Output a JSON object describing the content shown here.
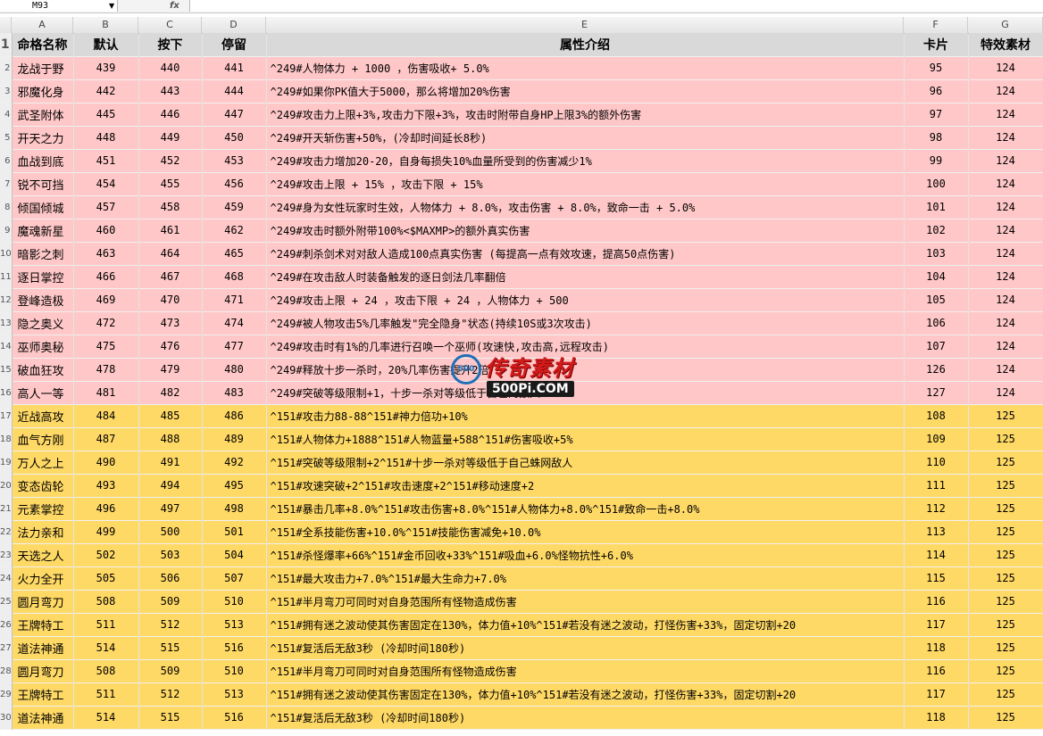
{
  "formula_bar": {
    "name_box": "M93",
    "fx": "fx"
  },
  "columns": [
    "A",
    "B",
    "C",
    "D",
    "E",
    "F",
    "G"
  ],
  "header_row": {
    "row_number": "1",
    "cells": [
      "命格名称",
      "默认",
      "按下",
      "停留",
      "属性介绍",
      "卡片",
      "特效素材"
    ]
  },
  "rows": [
    {
      "rn": "2",
      "group": "pink",
      "cells": [
        "龙战于野",
        "439",
        "440",
        "441",
        "^249#人物体力 + 1000 ，伤害吸收+ 5.0%",
        "95",
        "124"
      ]
    },
    {
      "rn": "3",
      "group": "pink",
      "cells": [
        "邪魔化身",
        "442",
        "443",
        "444",
        "^249#如果你PK值大于5000，那么将增加20%伤害",
        "96",
        "124"
      ]
    },
    {
      "rn": "4",
      "group": "pink",
      "cells": [
        "武圣附体",
        "445",
        "446",
        "447",
        "^249#攻击力上限+3%,攻击力下限+3%，攻击时附带自身HP上限3%的额外伤害",
        "97",
        "124"
      ]
    },
    {
      "rn": "5",
      "group": "pink",
      "cells": [
        "开天之力",
        "448",
        "449",
        "450",
        "^249#开天斩伤害+50%，(冷却时间延长8秒)",
        "98",
        "124"
      ]
    },
    {
      "rn": "6",
      "group": "pink",
      "cells": [
        "血战到底",
        "451",
        "452",
        "453",
        "^249#攻击力增加20-20，自身每损失10%血量所受到的伤害减少1%",
        "99",
        "124"
      ]
    },
    {
      "rn": "7",
      "group": "pink",
      "cells": [
        "锐不可挡",
        "454",
        "455",
        "456",
        "^249#攻击上限 + 15% ，攻击下限 + 15%",
        "100",
        "124"
      ]
    },
    {
      "rn": "8",
      "group": "pink",
      "cells": [
        "倾国倾城",
        "457",
        "458",
        "459",
        "^249#身为女性玩家时生效，人物体力 + 8.0%，攻击伤害 + 8.0%，致命一击 + 5.0%",
        "101",
        "124"
      ]
    },
    {
      "rn": "9",
      "group": "pink",
      "cells": [
        "魔魂新星",
        "460",
        "461",
        "462",
        "^249#攻击时额外附带100%<$MAXMP>的额外真实伤害",
        "102",
        "124"
      ]
    },
    {
      "rn": "10",
      "group": "pink",
      "cells": [
        "暗影之刺",
        "463",
        "464",
        "465",
        "^249#刺杀剑术对对敌人造成100点真实伤害 (每提高一点有效攻速，提高50点伤害)",
        "103",
        "124"
      ]
    },
    {
      "rn": "11",
      "group": "pink",
      "cells": [
        "逐日掌控",
        "466",
        "467",
        "468",
        "^249#在攻击敌人时装备触发的逐日剑法几率翻倍",
        "104",
        "124"
      ]
    },
    {
      "rn": "12",
      "group": "pink",
      "cells": [
        "登峰造极",
        "469",
        "470",
        "471",
        "^249#攻击上限 + 24 ，攻击下限 + 24 ，人物体力 + 500",
        "105",
        "124"
      ]
    },
    {
      "rn": "13",
      "group": "pink",
      "cells": [
        "隐之奥义",
        "472",
        "473",
        "474",
        "^249#被人物攻击5%几率触发\"完全隐身\"状态(持续10S或3次攻击)",
        "106",
        "124"
      ]
    },
    {
      "rn": "14",
      "group": "pink",
      "cells": [
        "巫师奥秘",
        "475",
        "476",
        "477",
        "^249#攻击时有1%的几率进行召唤一个巫师(攻速快,攻击高,远程攻击)",
        "107",
        "124"
      ]
    },
    {
      "rn": "15",
      "group": "pink",
      "cells": [
        "破血狂攻",
        "478",
        "479",
        "480",
        "^249#释放十步一杀时，20%几率伤害提升2倍",
        "126",
        "124"
      ]
    },
    {
      "rn": "16",
      "group": "pink",
      "cells": [
        "高人一等",
        "481",
        "482",
        "483",
        "^249#突破等级限制+1，十步一杀对等级低于自己的敌人",
        "127",
        "124"
      ]
    },
    {
      "rn": "17",
      "group": "gold",
      "cells": [
        "近战高攻",
        "484",
        "485",
        "486",
        "^151#攻击力88-88^151#神力倍功+10%",
        "108",
        "125"
      ]
    },
    {
      "rn": "18",
      "group": "gold",
      "cells": [
        "血气方刚",
        "487",
        "488",
        "489",
        "^151#人物体力+1888^151#人物蓝量+588^151#伤害吸收+5%",
        "109",
        "125"
      ]
    },
    {
      "rn": "19",
      "group": "gold",
      "cells": [
        "万人之上",
        "490",
        "491",
        "492",
        "^151#突破等级限制+2^151#十步一杀对等级低于自己蛛网敌人",
        "110",
        "125"
      ]
    },
    {
      "rn": "20",
      "group": "gold",
      "cells": [
        "变态齿轮",
        "493",
        "494",
        "495",
        "^151#攻速突破+2^151#攻击速度+2^151#移动速度+2",
        "111",
        "125"
      ]
    },
    {
      "rn": "21",
      "group": "gold",
      "cells": [
        "元素掌控",
        "496",
        "497",
        "498",
        "^151#暴击几率+8.0%^151#攻击伤害+8.0%^151#人物体力+8.0%^151#致命一击+8.0%",
        "112",
        "125"
      ]
    },
    {
      "rn": "22",
      "group": "gold",
      "cells": [
        "法力亲和",
        "499",
        "500",
        "501",
        "^151#全系技能伤害+10.0%^151#技能伤害减免+10.0%",
        "113",
        "125"
      ]
    },
    {
      "rn": "23",
      "group": "gold",
      "cells": [
        "天选之人",
        "502",
        "503",
        "504",
        "^151#杀怪爆率+66%^151#金币回收+33%^151#吸血+6.0%怪物抗性+6.0%",
        "114",
        "125"
      ]
    },
    {
      "rn": "24",
      "group": "gold",
      "cells": [
        "火力全开",
        "505",
        "506",
        "507",
        "^151#最大攻击力+7.0%^151#最大生命力+7.0%",
        "115",
        "125"
      ]
    },
    {
      "rn": "25",
      "group": "gold",
      "cells": [
        "圆月弯刀",
        "508",
        "509",
        "510",
        "^151#半月弯刀可同时对自身范围所有怪物造成伤害",
        "116",
        "125"
      ]
    },
    {
      "rn": "26",
      "group": "gold",
      "cells": [
        "王牌特工",
        "511",
        "512",
        "513",
        "^151#拥有迷之波动使其伤害固定在130%，体力值+10%^151#若没有迷之波动，打怪伤害+33%，固定切割+20",
        "117",
        "125"
      ]
    },
    {
      "rn": "27",
      "group": "gold",
      "cells": [
        "道法神通",
        "514",
        "515",
        "516",
        "^151#复活后无敌3秒 (冷却时间180秒)",
        "118",
        "125"
      ]
    },
    {
      "rn": "28",
      "group": "gold",
      "cells": [
        "圆月弯刀",
        "508",
        "509",
        "510",
        "^151#半月弯刀可同时对自身范围所有怪物造成伤害",
        "116",
        "125"
      ]
    },
    {
      "rn": "29",
      "group": "gold",
      "cells": [
        "王牌特工",
        "511",
        "512",
        "513",
        "^151#拥有迷之波动使其伤害固定在130%，体力值+10%^151#若没有迷之波动，打怪伤害+33%，固定切割+20",
        "117",
        "125"
      ]
    },
    {
      "rn": "30",
      "group": "gold",
      "cells": [
        "道法神通",
        "514",
        "515",
        "516",
        "^151#复活后无敌3秒 (冷却时间180秒)",
        "118",
        "125"
      ]
    }
  ],
  "watermark": {
    "brand": "传奇素材",
    "badge": "500",
    "url": "500Pi.COM"
  },
  "colors": {
    "pink_rows": "#ffc7c7",
    "gold_rows": "#ffd966",
    "header_row": "#d9d9d9"
  }
}
